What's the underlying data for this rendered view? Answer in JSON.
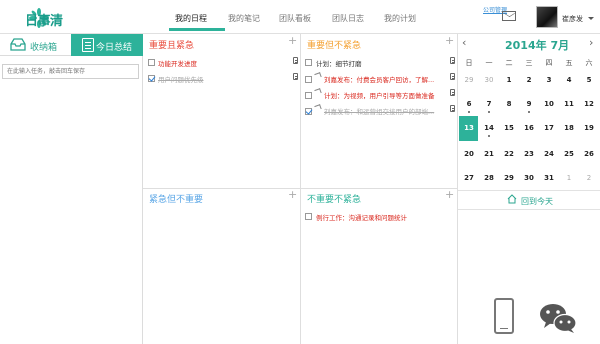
{
  "app": {
    "name": "日事清"
  },
  "nav": {
    "items": [
      "我的日程",
      "我的笔记",
      "团队看板",
      "团队日志",
      "我的计划"
    ],
    "active_index": 0
  },
  "header": {
    "company_link": "公司管理",
    "user_name": "崔彦发"
  },
  "sidebar": {
    "tab_inbox": "收纳箱",
    "tab_today": "今日总结",
    "search_placeholder": "在此输入任务，敲击回车保存"
  },
  "quadrants": {
    "q1": {
      "title": "重要且紧急",
      "color": "#e94d3e",
      "tasks": [
        {
          "text": "功能开发进度",
          "checked": false,
          "style": "red"
        },
        {
          "text": "用户问题优先级",
          "checked": true,
          "style": "done"
        }
      ]
    },
    "q2": {
      "title": "重要但不紧急",
      "color": "#f4a132",
      "tasks": [
        {
          "text": "计划：细节打磨",
          "checked": false,
          "style": "normal"
        },
        {
          "text": "刘嘉发布：付费会员客户回访，了解...",
          "checked": false,
          "style": "red"
        },
        {
          "text": "计划：为视频，用户引导等方面做准备",
          "checked": false,
          "style": "red"
        },
        {
          "text": "刘嘉发布：和运营组交接用户的部端...",
          "checked": true,
          "style": "done"
        }
      ]
    },
    "q3": {
      "title": "紧急但不重要",
      "color": "#5aa6e6",
      "tasks": []
    },
    "q4": {
      "title": "不重要不紧急",
      "color": "#2db29a",
      "tasks": [
        {
          "text": "例行工作：沟通记录和问题统计",
          "checked": false,
          "style": "red"
        }
      ]
    }
  },
  "calendar": {
    "title": "2014年 7月",
    "prev": "‹",
    "next": "›",
    "weekdays": [
      "日",
      "一",
      "二",
      "三",
      "四",
      "五",
      "六"
    ],
    "weeks": [
      [
        "29",
        "30",
        "1",
        "2",
        "3",
        "4",
        "5"
      ],
      [
        "6",
        "7",
        "8",
        "9",
        "10",
        "11",
        "12"
      ],
      [
        "13",
        "14",
        "15",
        "16",
        "17",
        "18",
        "19"
      ],
      [
        "20",
        "21",
        "22",
        "23",
        "24",
        "25",
        "26"
      ],
      [
        "27",
        "28",
        "29",
        "30",
        "31",
        "1",
        "2"
      ]
    ],
    "back_to_today": "回到今天"
  }
}
